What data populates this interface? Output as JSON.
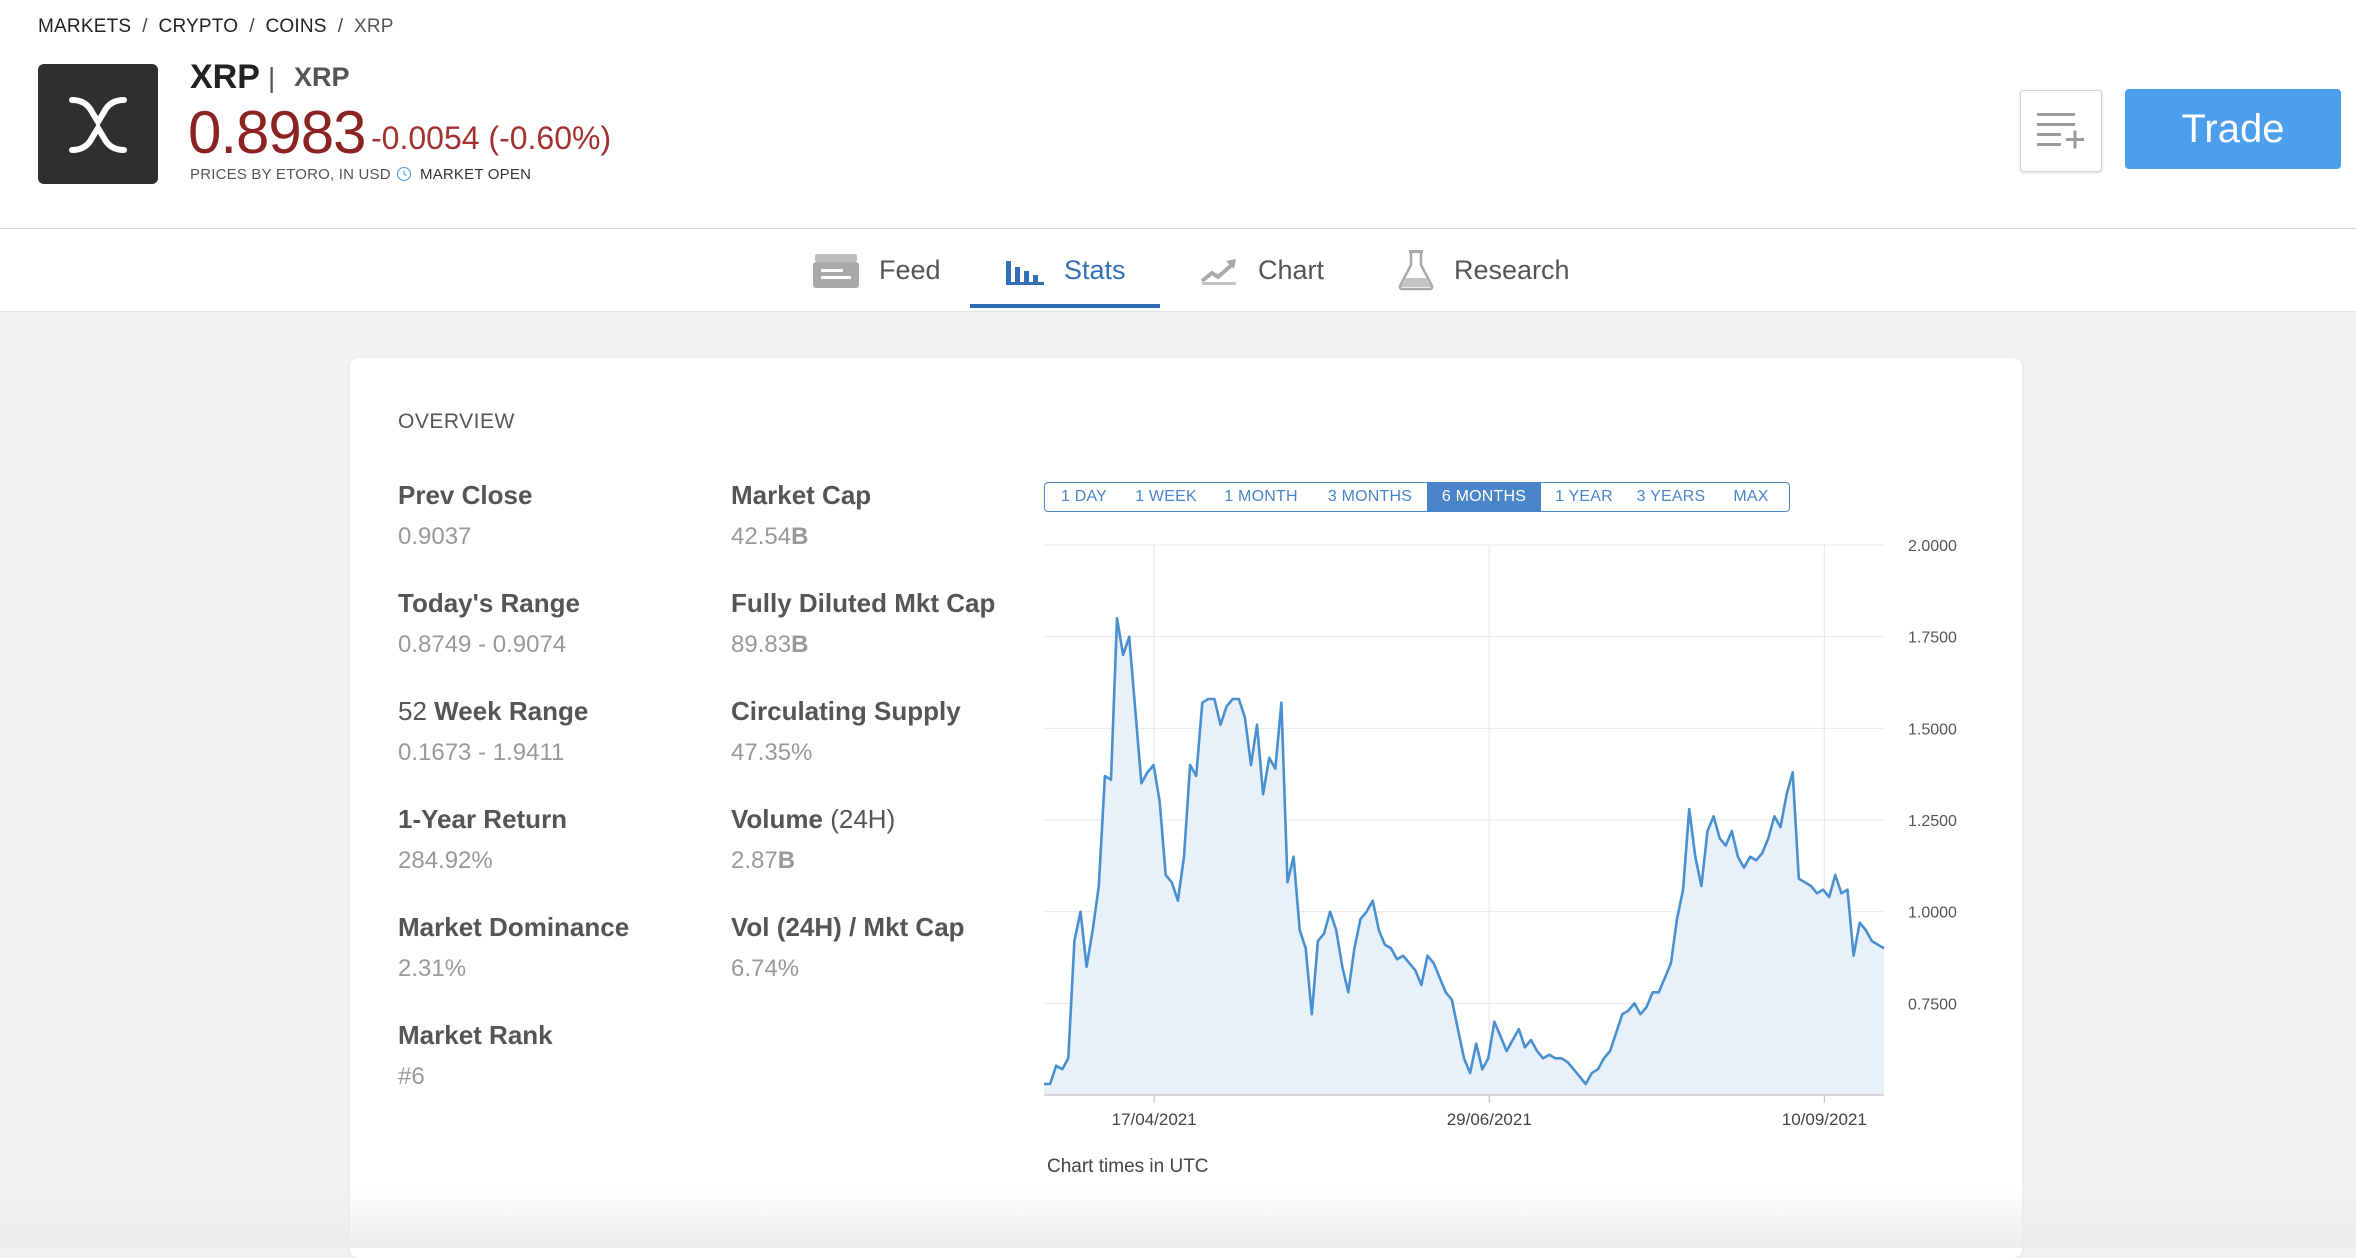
{
  "breadcrumb": [
    "MARKETS",
    "CRYPTO",
    "COINS",
    "XRP"
  ],
  "breadcrumb_separator": "/",
  "instrument": {
    "name": "XRP",
    "divider": "|",
    "symbol": "XRP",
    "price": "0.8983",
    "change": "-0.0054 (-0.60%)",
    "price_source": "PRICES BY ETORO, IN USD",
    "market_status": "MARKET OPEN"
  },
  "actions": {
    "trade_label": "Trade",
    "watchlist_icon": "add-to-watchlist-icon"
  },
  "tabs": [
    {
      "label": "Feed",
      "icon": "feed-icon"
    },
    {
      "label": "Stats",
      "icon": "stats-icon",
      "active": true
    },
    {
      "label": "Chart",
      "icon": "chart-icon"
    },
    {
      "label": "Research",
      "icon": "research-icon"
    }
  ],
  "overview": {
    "title": "OVERVIEW",
    "stats_left": [
      {
        "label": "Prev Close",
        "value": "0.9037"
      },
      {
        "label": "Today's Range",
        "value": "0.8749 - 0.9074"
      },
      {
        "label_prefix": "52",
        "label": "Week Range",
        "value": "0.1673 - 1.9411"
      },
      {
        "label": "1-Year Return",
        "value": "284.92%"
      },
      {
        "label": "Market Dominance",
        "value": "2.31%"
      },
      {
        "label": "Market Rank",
        "value": "#6"
      }
    ],
    "stats_right": [
      {
        "label": "Market Cap",
        "value_num": "42.54",
        "value_unit": "B"
      },
      {
        "label": "Fully Diluted Mkt Cap",
        "value_num": "89.83",
        "value_unit": "B"
      },
      {
        "label": "Circulating Supply",
        "value_num": "47.35%",
        "value_unit": ""
      },
      {
        "label": "Volume",
        "label_suffix": "(24H)",
        "value_num": "2.87",
        "value_unit": "B"
      },
      {
        "label": "Vol (24H) / Mkt Cap",
        "value_num": "6.74%",
        "value_unit": ""
      }
    ]
  },
  "chart_ranges": [
    "1 DAY",
    "1 WEEK",
    "1 MONTH",
    "3 MONTHS",
    "6 MONTHS",
    "1 YEAR",
    "3 YEARS",
    "MAX"
  ],
  "chart_selected_range": "6 MONTHS",
  "chart_note": "Chart times in UTC",
  "colors": {
    "accent": "#4d9fee",
    "price": "#8c2323",
    "change_negative": "#a33232",
    "line": "#4a90d0",
    "area": "#e8f1fa"
  },
  "chart_data": {
    "type": "area",
    "yticks": [
      "2.0000",
      "1.7500",
      "1.5000",
      "1.2500",
      "1.0000",
      "0.7500"
    ],
    "ylim": [
      0.5,
      2.0
    ],
    "xticks": [
      "17/04/2021",
      "29/06/2021",
      "10/09/2021"
    ],
    "x_start": "2021-03-24",
    "x_end": "2021-09-23",
    "series": [
      {
        "values": [
          0.53,
          0.53,
          0.58,
          0.57,
          0.6,
          0.92,
          1.0,
          0.85,
          0.95,
          1.07,
          1.37,
          1.36,
          1.8,
          1.7,
          1.75,
          1.55,
          1.35,
          1.38,
          1.4,
          1.3,
          1.1,
          1.08,
          1.03,
          1.15,
          1.4,
          1.37,
          1.57,
          1.58,
          1.58,
          1.51,
          1.56,
          1.58,
          1.58,
          1.53,
          1.4,
          1.51,
          1.32,
          1.42,
          1.39,
          1.57,
          1.08,
          1.15,
          0.95,
          0.9,
          0.72,
          0.92,
          0.94,
          1.0,
          0.95,
          0.85,
          0.78,
          0.9,
          0.98,
          1.0,
          1.03,
          0.95,
          0.91,
          0.9,
          0.87,
          0.88,
          0.86,
          0.84,
          0.8,
          0.88,
          0.86,
          0.82,
          0.78,
          0.76,
          0.68,
          0.6,
          0.56,
          0.64,
          0.57,
          0.6,
          0.7,
          0.66,
          0.62,
          0.65,
          0.68,
          0.63,
          0.65,
          0.62,
          0.6,
          0.61,
          0.6,
          0.6,
          0.59,
          0.57,
          0.55,
          0.53,
          0.56,
          0.57,
          0.6,
          0.62,
          0.67,
          0.72,
          0.73,
          0.75,
          0.72,
          0.74,
          0.78,
          0.78,
          0.82,
          0.86,
          0.98,
          1.06,
          1.28,
          1.15,
          1.07,
          1.22,
          1.26,
          1.2,
          1.18,
          1.22,
          1.15,
          1.12,
          1.15,
          1.14,
          1.16,
          1.2,
          1.26,
          1.23,
          1.32,
          1.38,
          1.09,
          1.08,
          1.07,
          1.05,
          1.06,
          1.04,
          1.1,
          1.05,
          1.06,
          0.88,
          0.97,
          0.95,
          0.92,
          0.91,
          0.9
        ]
      }
    ]
  }
}
